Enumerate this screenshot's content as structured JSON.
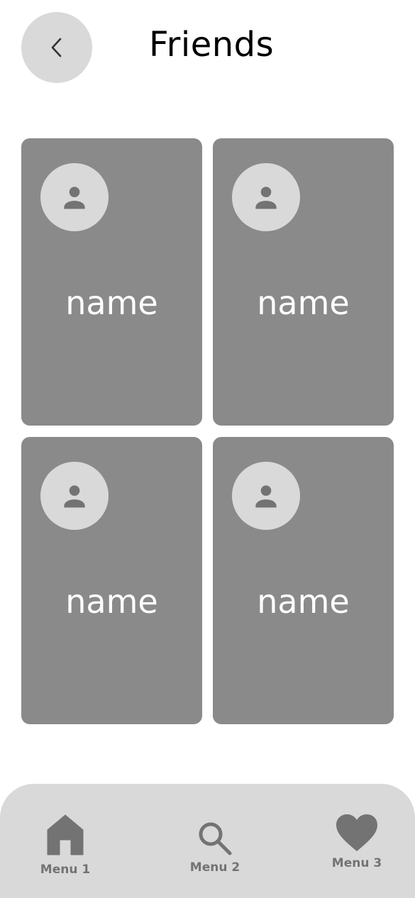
{
  "header": {
    "title": "Friends",
    "back_icon": "chevron-left-icon"
  },
  "friends": [
    {
      "name": "name",
      "avatar_icon": "person-icon"
    },
    {
      "name": "name",
      "avatar_icon": "person-icon"
    },
    {
      "name": "name",
      "avatar_icon": "person-icon"
    },
    {
      "name": "name",
      "avatar_icon": "person-icon"
    }
  ],
  "bottom_nav": {
    "items": [
      {
        "label": "Menu 1",
        "icon": "home-icon"
      },
      {
        "label": "Menu 2",
        "icon": "search-icon"
      },
      {
        "label": "Menu 3",
        "icon": "heart-icon"
      }
    ]
  },
  "colors": {
    "background": "#ffffff",
    "card": "#8a8a8a",
    "avatar_bg": "#d9d9d9",
    "icon": "#737373",
    "nav_bg": "#d9d9d9",
    "text_light": "#ffffff",
    "title": "#000000"
  }
}
